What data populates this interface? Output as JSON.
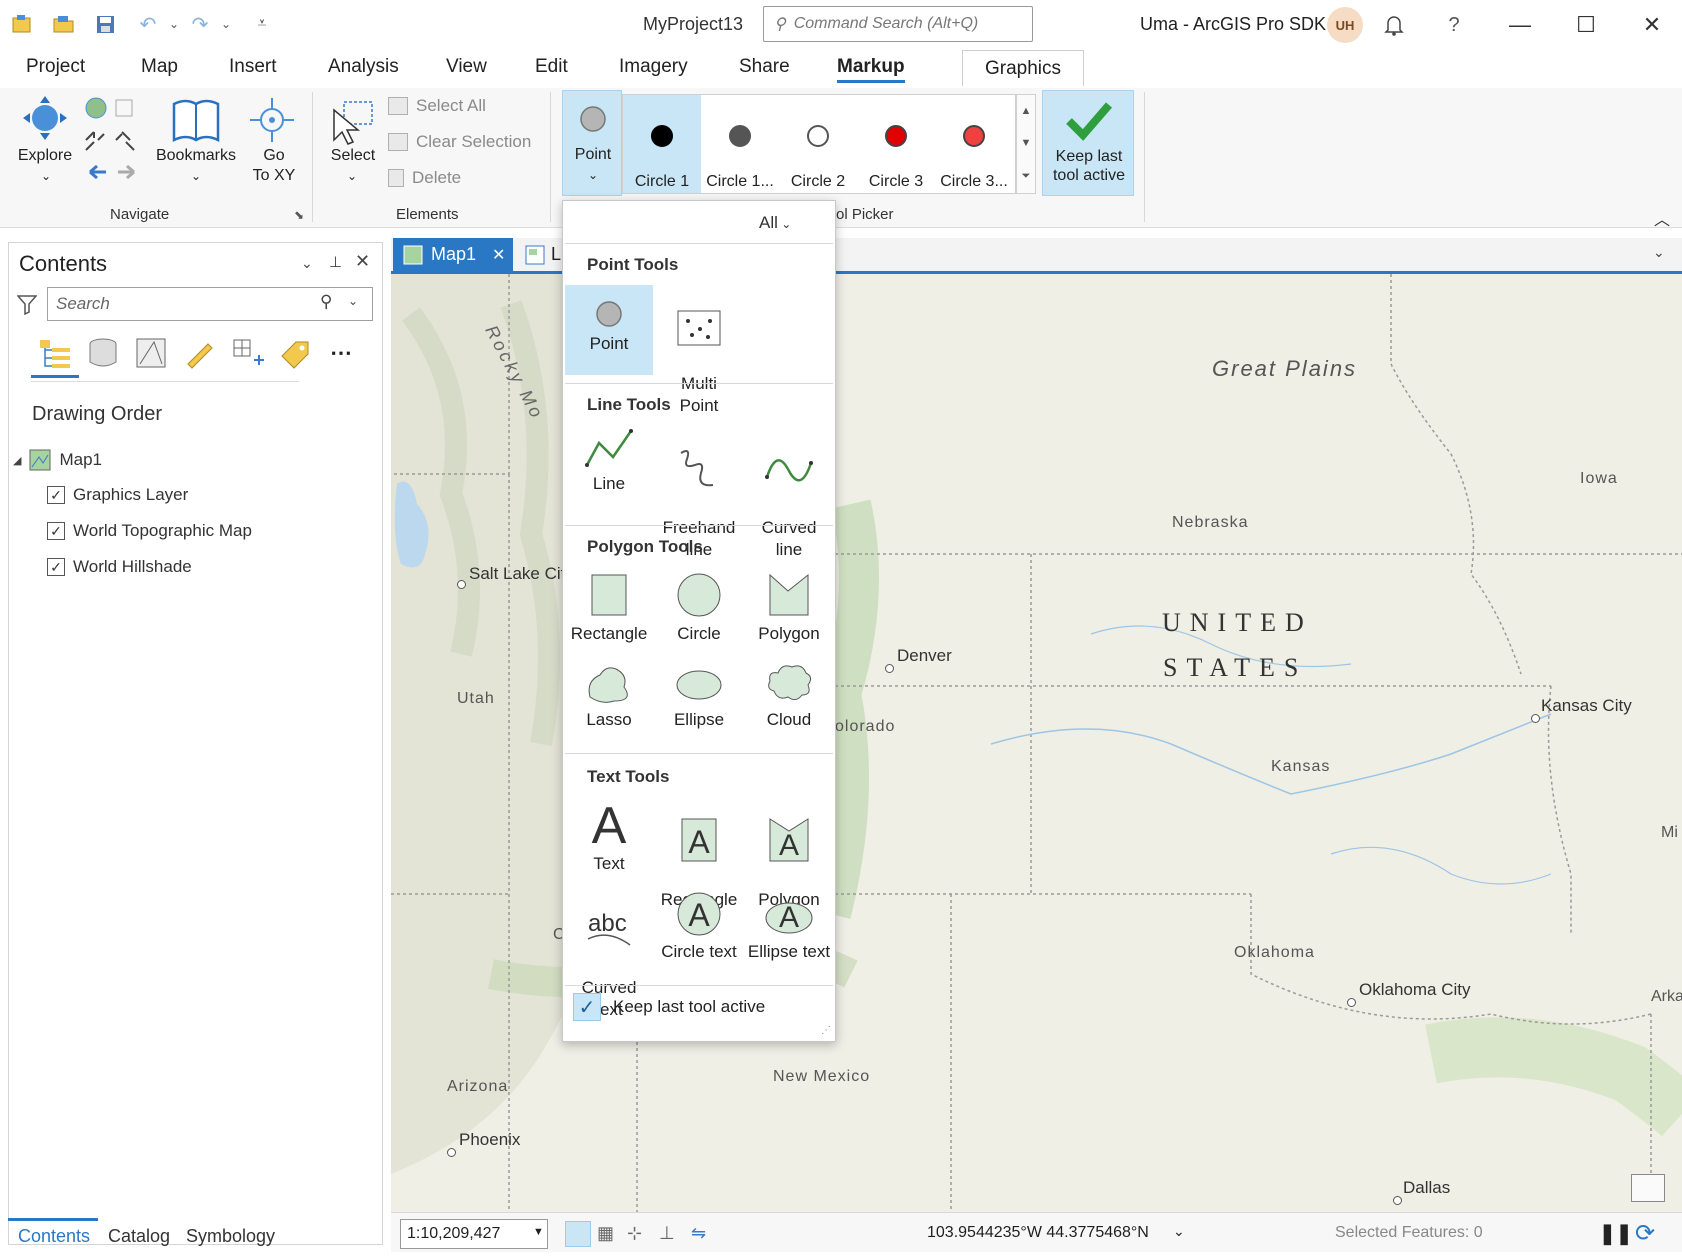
{
  "titlebar": {
    "project_name": "MyProject13",
    "command_search_placeholder": "Command Search (Alt+Q)",
    "user_name": "Uma - ArcGIS Pro SDK",
    "avatar_initials": "UH",
    "help": "?"
  },
  "ribbon_tabs": [
    "Project",
    "Map",
    "Insert",
    "Analysis",
    "View",
    "Edit",
    "Imagery",
    "Share",
    "Markup",
    "Graphics"
  ],
  "active_tab": "Markup",
  "ribbon": {
    "navigate": {
      "explore": "Explore",
      "bookmarks": "Bookmarks",
      "go_to_xy": "Go\nTo XY",
      "group_label": "Navigate"
    },
    "elements": {
      "select": "Select",
      "select_all": "Select All",
      "clear_selection": "Clear Selection",
      "delete": "Delete",
      "group_label": "Elements"
    },
    "point_button": "Point",
    "tool_gallery": [
      {
        "label": "Circle 1",
        "fill": "#000000",
        "stroke": "#000000"
      },
      {
        "label": "Circle 1...",
        "fill": "#555555",
        "stroke": "#555555"
      },
      {
        "label": "Circle 2",
        "fill": "#ffffff",
        "stroke": "#555555"
      },
      {
        "label": "Circle 3",
        "fill": "#e00000",
        "stroke": "#444444"
      },
      {
        "label": "Circle 3...",
        "fill": "#f04040",
        "stroke": "#444444"
      }
    ],
    "keep_last_label": "Keep last\ntool active",
    "tool_picker_label": "ol Picker"
  },
  "contents": {
    "title": "Contents",
    "search_placeholder": "Search",
    "drawing_order": "Drawing Order",
    "map_name": "Map1",
    "layers": [
      {
        "name": "Graphics Layer",
        "checked": true
      },
      {
        "name": "World Topographic Map",
        "checked": true
      },
      {
        "name": "World Hillshade",
        "checked": true
      }
    ],
    "bottom_tabs": [
      "Contents",
      "Catalog",
      "Symbology"
    ]
  },
  "map_view": {
    "tab_label": "Map1",
    "second_tab_label": "L",
    "labels": {
      "great_plains": "Great Plains",
      "rocky": "Rocky Mo",
      "nebraska": "Nebraska",
      "iowa": "Iowa",
      "united": "UNITED",
      "states": "STATES",
      "kansas": "Kansas",
      "colorado": "olorado",
      "utah": "Utah",
      "oklahoma": "Oklahoma",
      "new_mexico": "New Mexico",
      "arizona": "Arizona",
      "mi": "Mi",
      "arka": "Arka",
      "c_partial": "C"
    },
    "cities": {
      "salt_lake": "Salt Lake Cit",
      "denver": "Denver",
      "kansas_city": "Kansas City",
      "oklahoma_city": "Oklahoma City",
      "phoenix": "Phoenix",
      "dallas": "Dallas"
    }
  },
  "statusbar": {
    "scale": "1:10,209,427",
    "coordinates": "103.9544235°W 44.3775468°N",
    "selected_features": "Selected Features: 0"
  },
  "dropdown": {
    "filter": "All",
    "sections": {
      "point": "Point Tools",
      "line": "Line Tools",
      "polygon": "Polygon Tools",
      "text": "Text Tools"
    },
    "point_tools": {
      "point": "Point",
      "multipoint": "Multi\nPoint"
    },
    "line_tools": {
      "line": "Line",
      "freehand": "Freehand\nline",
      "curved": "Curved\nline"
    },
    "polygon_tools": {
      "rectangle": "Rectangle",
      "circle": "Circle",
      "polygon": "Polygon",
      "lasso": "Lasso",
      "ellipse": "Ellipse",
      "cloud": "Cloud"
    },
    "text_tools": {
      "text": "Text",
      "rectangle_text": "Rectangle\ntext",
      "polygon_text": "Polygon\ntext",
      "curved_text": "Curved\ntext",
      "circle_text": "Circle text",
      "ellipse_text": "Ellipse text"
    },
    "keep_last": "Keep last tool active"
  },
  "colors": {
    "accent": "#2a78c4",
    "selection": "#c9e6f7",
    "tool_fill": "#d7ead9",
    "tool_stroke": "#3f8a3f"
  }
}
